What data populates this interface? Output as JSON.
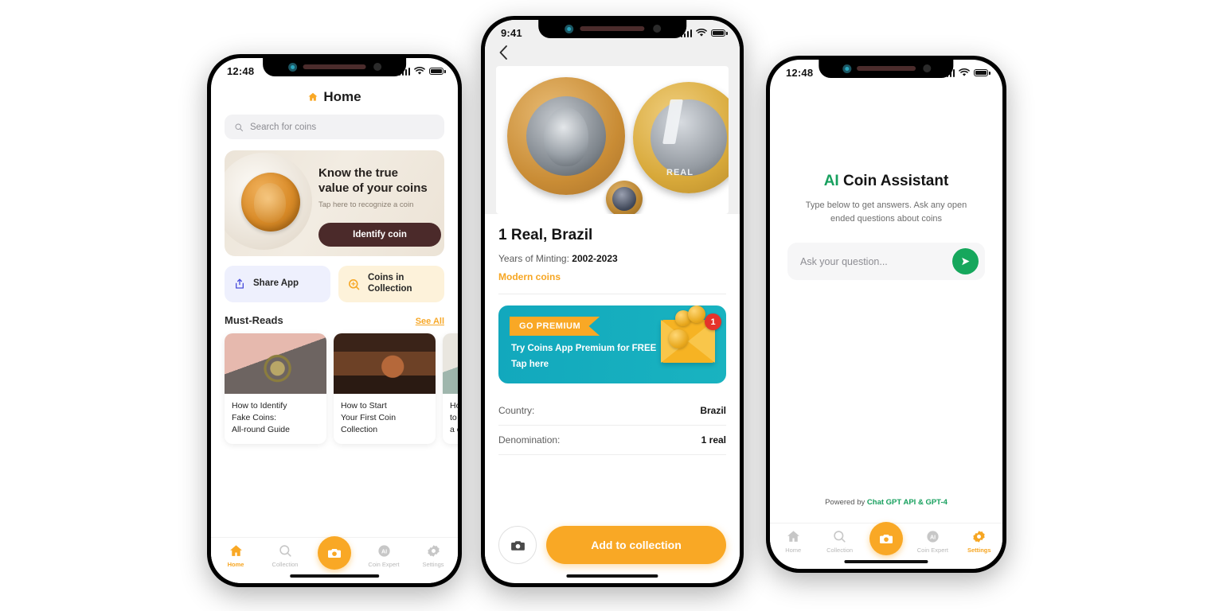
{
  "colors": {
    "accent_orange": "#f9a825",
    "teal": "#12a8bd",
    "green": "#17a05e",
    "dark_button": "#4b2a2a",
    "badge_red": "#e5332a"
  },
  "phone_home": {
    "status": {
      "time": "12:48",
      "signal_icon": "signal-bars-icon",
      "wifi_icon": "wifi-icon",
      "battery_icon": "battery-icon"
    },
    "title": "Home",
    "title_icon": "home-icon",
    "search": {
      "placeholder": "Search for coins",
      "icon": "search-icon"
    },
    "hero": {
      "heading_line1": "Know the true",
      "heading_line2": "value of your coins",
      "subtitle": "Tap here to recognize a coin",
      "button": "Identify coin",
      "image": "gold-coin-on-plate-photo"
    },
    "tiles": [
      {
        "label": "Share App",
        "icon": "share-icon"
      },
      {
        "label_line1": "Coins in",
        "label_line2": "Collection",
        "icon": "coin-search-icon"
      }
    ],
    "must_reads": {
      "title": "Must-Reads",
      "see_all": "See All",
      "cards": [
        {
          "line1": "How to Identify",
          "line2": "Fake Coins:",
          "line3": "All-round Guide",
          "image": "hand-holding-coin-photo"
        },
        {
          "line1": "How to Start",
          "line2": "Your First Coin",
          "line3": "Collection",
          "image": "stacked-copper-coins-photo"
        },
        {
          "line1": "How",
          "line2": "to v",
          "line3": "a c",
          "image": "coins-and-banknotes-photo"
        }
      ]
    },
    "tabs": [
      {
        "label": "Home",
        "icon": "home-icon",
        "active": true
      },
      {
        "label": "Collection",
        "icon": "coin-search-icon",
        "active": false
      },
      {
        "label": "",
        "icon": "camera-icon",
        "active": false
      },
      {
        "label": "Coin Expert",
        "icon": "ai-icon",
        "active": false
      },
      {
        "label": "Settings",
        "icon": "gear-icon",
        "active": false
      }
    ]
  },
  "phone_detail": {
    "status": {
      "time": "9:41"
    },
    "back_icon": "chevron-left-icon",
    "photo": "brazil-one-real-coins-photo",
    "title": "1 Real, Brazil",
    "minting_label": "Years of Minting:",
    "minting_value": "2002-2023",
    "category": "Modern coins",
    "promo": {
      "ribbon": "GO PREMIUM",
      "line1": "Try Coins App Premium for FREE",
      "line2": "Tap here",
      "badge": "1",
      "icon": "envelope-with-coins-icon"
    },
    "specs": [
      {
        "key": "Country:",
        "value": "Brazil"
      },
      {
        "key": "Denomination:",
        "value": "1 real"
      }
    ],
    "camera_button_icon": "camera-icon",
    "primary_button": "Add to collection"
  },
  "phone_assistant": {
    "status": {
      "time": "12:48"
    },
    "title_accent": "AI",
    "title_rest": " Coin Assistant",
    "subtitle_line1": "Type below to get answers. Ask any open",
    "subtitle_line2": "ended questions about coins",
    "input": {
      "placeholder": "Ask your question...",
      "value": ""
    },
    "send_icon": "send-icon",
    "powered_prefix": "Powered by ",
    "powered_brand": "Chat GPT API & GPT-4",
    "tabs": [
      {
        "label": "Home",
        "icon": "home-icon",
        "active": false
      },
      {
        "label": "Collection",
        "icon": "coin-search-icon",
        "active": false
      },
      {
        "label": "",
        "icon": "camera-icon",
        "active": false
      },
      {
        "label": "Coin Expert",
        "icon": "ai-icon",
        "active": false
      },
      {
        "label": "Settings",
        "icon": "gear-icon",
        "active": true
      }
    ]
  }
}
